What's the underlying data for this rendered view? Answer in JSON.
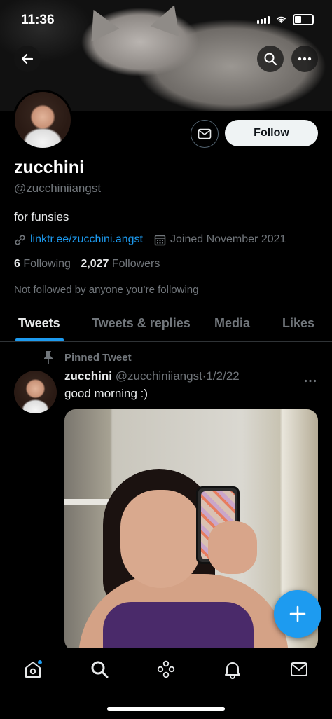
{
  "status_bar": {
    "time": "11:36"
  },
  "profile": {
    "display_name": "zucchini",
    "handle": "@zucchiniiangst",
    "bio": "for funsies",
    "link": "linktr.ee/zucchini.angst",
    "joined": "Joined November 2021",
    "following_count": "6",
    "following_label": "Following",
    "followers_count": "2,027",
    "followers_label": "Followers",
    "not_followed_text": "Not followed by anyone you’re following",
    "follow_button": "Follow"
  },
  "tabs": [
    {
      "label": "Tweets",
      "active": true
    },
    {
      "label": "Tweets & replies",
      "active": false
    },
    {
      "label": "Media",
      "active": false
    },
    {
      "label": "Likes",
      "active": false
    }
  ],
  "pinned_tweet": {
    "pinned_label": "Pinned Tweet",
    "author_name": "zucchini",
    "author_handle": "@zucchiniiangst",
    "separator": "·",
    "date": "1/2/22",
    "text": "good morning :)"
  },
  "colors": {
    "accent": "#1d9bf0",
    "background": "#000000",
    "text_primary": "#e7e9ea",
    "text_secondary": "#71767b",
    "border": "#2f3336"
  },
  "icons": {
    "back": "arrow-left-icon",
    "search": "search-icon",
    "more": "more-icon",
    "message": "envelope-icon",
    "link": "link-icon",
    "calendar": "calendar-icon",
    "pin": "pin-icon",
    "compose": "plus-icon",
    "nav_home": "home-icon",
    "nav_search": "search-icon",
    "nav_spaces": "spaces-icon",
    "nav_notifications": "bell-icon",
    "nav_messages": "envelope-icon"
  }
}
